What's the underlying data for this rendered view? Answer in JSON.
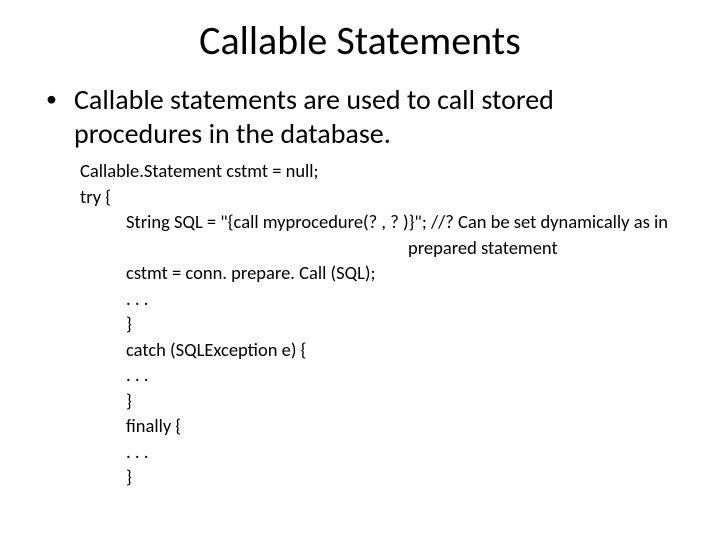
{
  "title": "Callable Statements",
  "bullet": {
    "marker": "•",
    "text": "Callable statements are used to call stored procedures in the database."
  },
  "code": {
    "l1": "Callable.Statement cstmt = null;",
    "l2": "try {",
    "l3a": "String SQL = \"{call myprocedure(? , ? )}\";  //? Can be set dynamically as in",
    "l3b": "prepared statement",
    "l4": "cstmt = conn. prepare. Call (SQL);",
    "l5": ". . .",
    "l6": "}",
    "l7": "catch (SQLException e) {",
    "l8": ". . .",
    "l9": "}",
    "l10": "finally {",
    "l11": ". . .",
    "l12": "}"
  }
}
